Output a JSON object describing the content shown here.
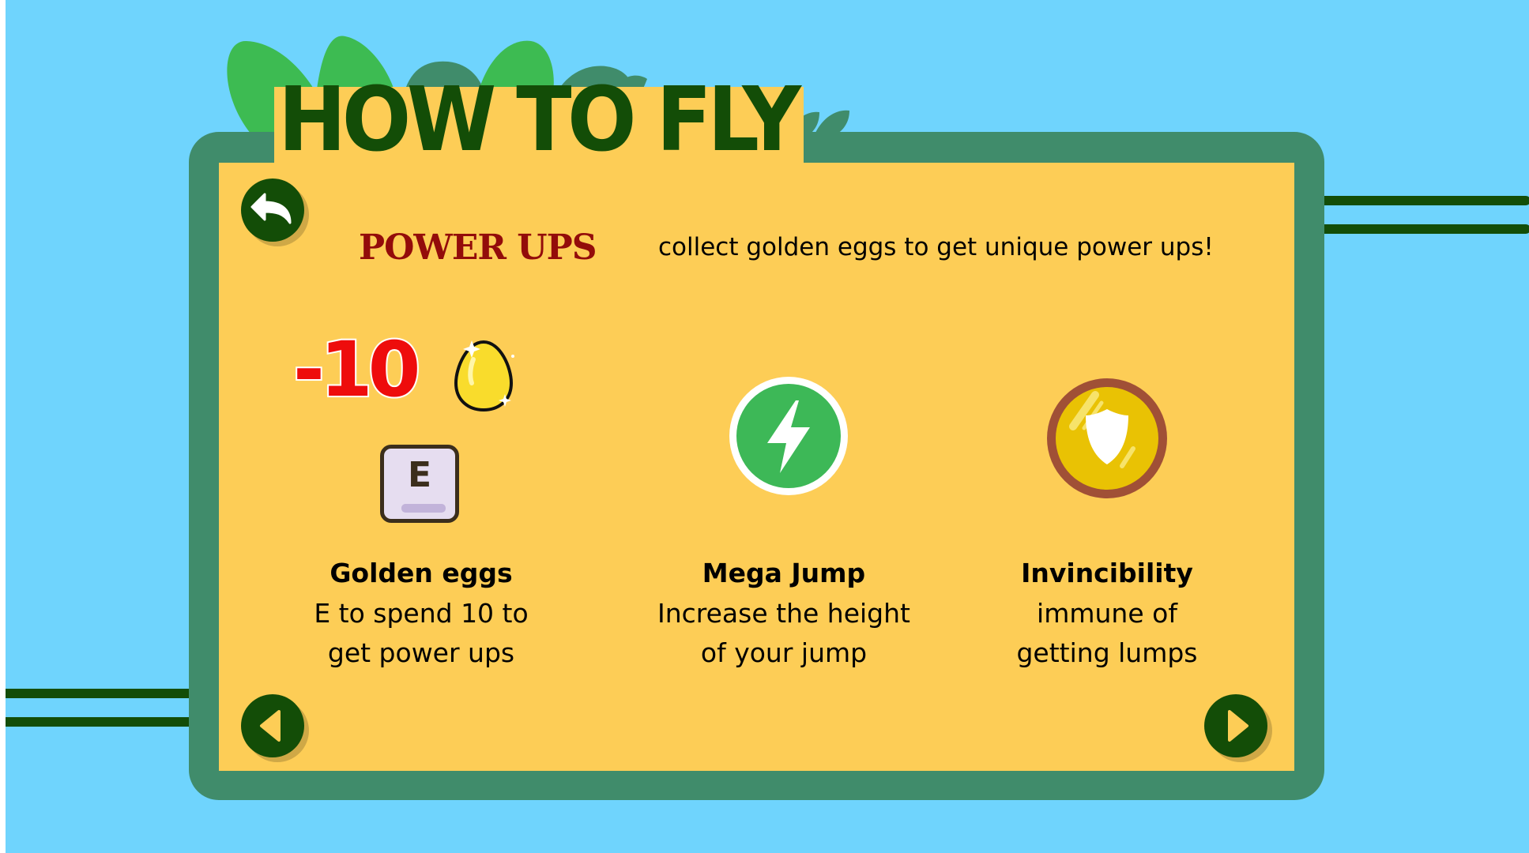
{
  "title": "HOW TO FLY",
  "section": {
    "heading": "POWER UPS",
    "intro": "collect golden eggs to get unique power ups!"
  },
  "powerups": [
    {
      "cost": "-10",
      "key": "E",
      "name": "Golden eggs",
      "line1": "E to spend 10 to",
      "line2": "get power ups"
    },
    {
      "name": "Mega Jump",
      "line1": "Increase the height",
      "line2": "of your jump"
    },
    {
      "name": "Invincibility",
      "line1": "immune of",
      "line2": "getting lumps"
    }
  ],
  "icons": {
    "back": "back-arrow-icon",
    "prev": "previous-arrow-icon",
    "next": "next-arrow-icon",
    "egg": "golden-egg-icon",
    "key": "e-key-icon",
    "jump": "lightning-icon",
    "invincibility": "shield-icon"
  },
  "colors": {
    "sky": "#6fd4fd",
    "frame": "#408c6b",
    "panel": "#fdcd56",
    "dark_green": "#134d07",
    "heading_red": "#930c0a",
    "cost_red": "#ee0c0c",
    "jump_green": "#3db857",
    "shield_gold": "#e9c204",
    "shield_rim": "#a05036"
  }
}
